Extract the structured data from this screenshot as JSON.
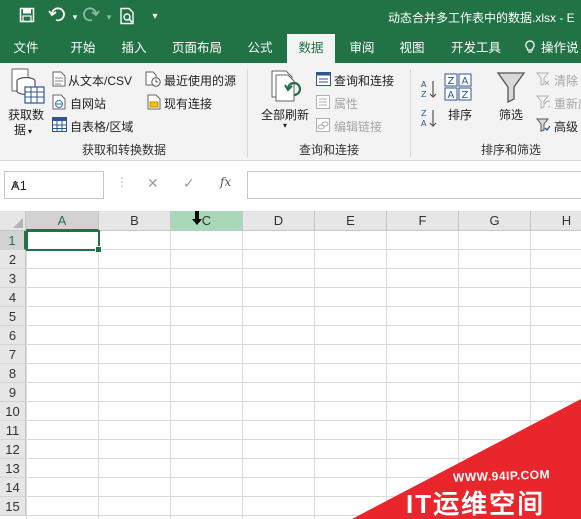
{
  "titlebar": {
    "document_title": "动态合并多工作表中的数据.xlsx  -  E",
    "quick_access": [
      "save-icon",
      "undo-icon",
      "redo-icon",
      "print-preview-icon",
      "customize-quick-access-icon"
    ]
  },
  "tabs": [
    {
      "label": "文件"
    },
    {
      "label": "开始"
    },
    {
      "label": "插入"
    },
    {
      "label": "页面布局"
    },
    {
      "label": "公式"
    },
    {
      "label": "数据",
      "active": true
    },
    {
      "label": "审阅"
    },
    {
      "label": "视图"
    },
    {
      "label": "开发工具"
    },
    {
      "label": "操作说"
    }
  ],
  "ribbon": {
    "get_transform": {
      "get_data_line1": "获取数",
      "get_data_line2": "据",
      "from_text": "从文本/CSV",
      "from_web": "自网站",
      "from_table": "自表格/区域",
      "recent_sources": "最近使用的源",
      "existing_connections": "现有连接",
      "group_label": "获取和转换数据"
    },
    "queries": {
      "refresh_all": "全部刷新",
      "queries_connections": "查询和连接",
      "properties": "属性",
      "edit_links": "编辑链接",
      "group_label": "查询和连接"
    },
    "sort_filter": {
      "sort": "排序",
      "filter": "筛选",
      "clear": "清除",
      "reapply": "重新应",
      "advanced": "高级",
      "group_label": "排序和筛选"
    }
  },
  "formula_bar": {
    "name_box": "A1",
    "fx_label": "fx",
    "formula": ""
  },
  "grid": {
    "columns": [
      "A",
      "B",
      "C",
      "D",
      "E",
      "F",
      "G",
      "H"
    ],
    "rows": [
      "1",
      "2",
      "3",
      "4",
      "5",
      "6",
      "7",
      "8",
      "9",
      "10",
      "11",
      "12",
      "13",
      "14",
      "15"
    ],
    "active_cell": "A1",
    "hovered_column": "C"
  },
  "watermark": {
    "url": "WWW.94IP.COM",
    "name": "IT运维空间"
  },
  "colors": {
    "accent": "#217346",
    "column_hover": "#a9d8b8",
    "watermark": "#e8262b"
  }
}
